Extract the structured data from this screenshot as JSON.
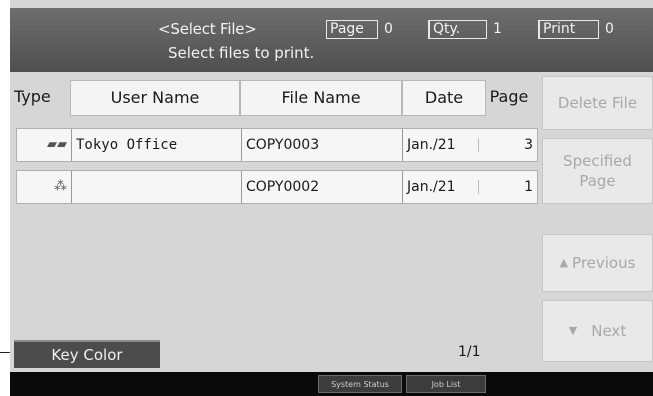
{
  "header": {
    "title": "<Select File>",
    "subtitle": "Select files to print.",
    "counters": [
      {
        "label": "Page",
        "value": "0"
      },
      {
        "label": "Qty.",
        "value": "1"
      },
      {
        "label": "Print",
        "value": "0"
      }
    ]
  },
  "table": {
    "columns": [
      "Type",
      "User Name",
      "File Name",
      "Date",
      "Page"
    ],
    "rows": [
      {
        "type_icon": "printer-icon",
        "type_glyph": "▰▰",
        "user": "Tokyo Office",
        "file": "COPY0003",
        "date": "Jan./21",
        "page": "3"
      },
      {
        "type_icon": "network-icon",
        "type_glyph": "⁂",
        "user": "",
        "file": "COPY0002",
        "date": "Jan./21",
        "page": "1"
      }
    ]
  },
  "side_buttons": {
    "delete": "Delete File",
    "specified_line1": "Specified",
    "specified_line2": "Page",
    "previous": "Previous",
    "next": "Next"
  },
  "footer": {
    "key_color": "Key Color",
    "page_count": "1/1"
  },
  "statusbar": {
    "system_status": "System Status",
    "job_list": "Job List"
  }
}
